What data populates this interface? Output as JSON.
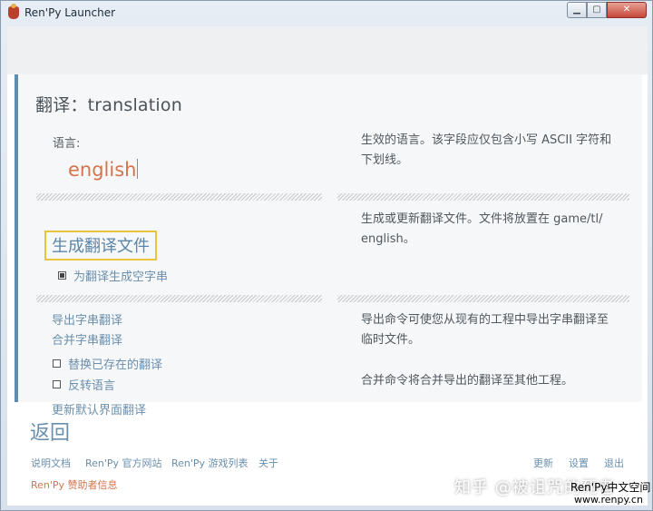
{
  "window": {
    "title": "Ren'Py Launcher",
    "controls": {
      "minimize": "▁",
      "maximize": "▢",
      "close": "✕"
    }
  },
  "page": {
    "title": "翻译：translation",
    "language": {
      "label": "语言:",
      "value": "english",
      "help_line1": "生效的语言。该字段应仅包含小写 ASCII 字符和",
      "help_line2": "下划线。"
    },
    "generate": {
      "button": "生成翻译文件",
      "checkbox_label": "为翻译生成空字串",
      "checkbox_checked": true,
      "help_line1": "生成或更新翻译文件。文件将放置在 game/tl/",
      "help_line2": "english。"
    },
    "strings": {
      "extract": "导出字串翻译",
      "merge": "合并字串翻译",
      "replace_label": "替换已存在的翻译",
      "replace_checked": false,
      "reverse_label": "反转语言",
      "reverse_checked": false,
      "update_default": "更新默认界面翻译",
      "help_extract_line1": "导出命令可使您从现有的工程中导出字串翻译至",
      "help_extract_line2": "临时文件。",
      "help_merge": "合并命令将合并导出的翻译至其他工程。"
    }
  },
  "footer": {
    "back": "返回",
    "links": [
      "说明文档",
      "Ren'Py 官方网站",
      "Ren'Py 游戏列表",
      "关于"
    ],
    "right_links": [
      "更新",
      "设置",
      "退出"
    ],
    "sponsor": "Ren'Py 赞助者信息"
  },
  "watermark": {
    "zhihu": "知乎 @被诅咒的死者",
    "cn_site": "Ren'Py中文空间",
    "url": "www.renpy.cn"
  },
  "colors": {
    "accent": "#6a8fad",
    "highlight": "#d4744d",
    "focus_border": "#e9c33b",
    "panel_bar": "#5f8db0"
  }
}
